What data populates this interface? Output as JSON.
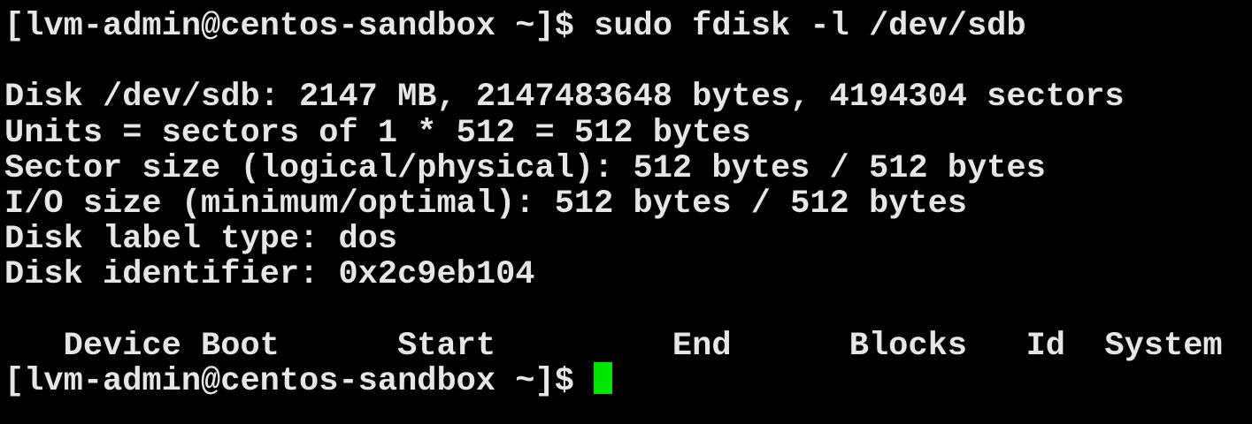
{
  "terminal": {
    "prompt": "[lvm-admin@centos-sandbox ~]$ ",
    "command": "sudo fdisk -l /dev/sdb",
    "output": [
      "",
      "Disk /dev/sdb: 2147 MB, 2147483648 bytes, 4194304 sectors",
      "Units = sectors of 1 * 512 = 512 bytes",
      "Sector size (logical/physical): 512 bytes / 512 bytes",
      "I/O size (minimum/optimal): 512 bytes / 512 bytes",
      "Disk label type: dos",
      "Disk identifier: 0x2c9eb104",
      "",
      "   Device Boot      Start         End      Blocks   Id  System"
    ],
    "current_prompt": "[lvm-admin@centos-sandbox ~]$ ",
    "cursor_color": "#00e600",
    "background_color": "#000000",
    "text_color": "#e6e6e6"
  }
}
